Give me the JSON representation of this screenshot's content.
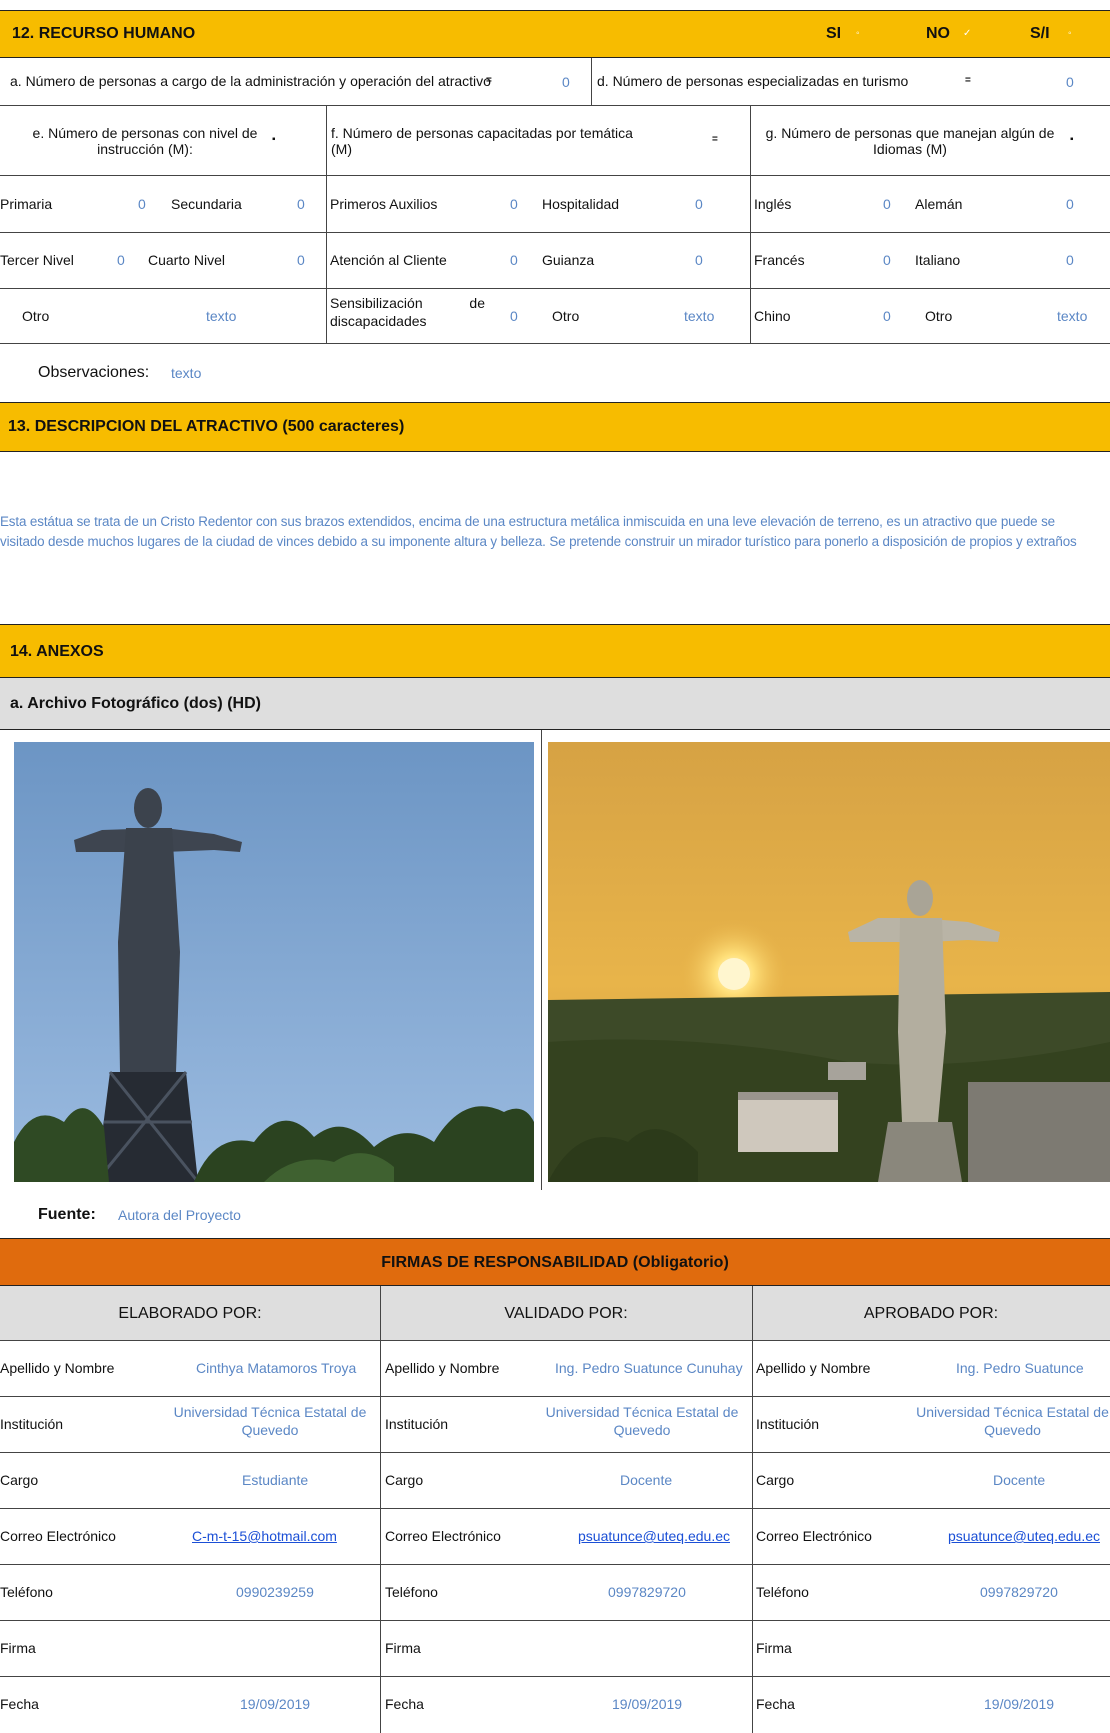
{
  "s12": {
    "title": "12. RECURSO HUMANO",
    "si": "SI",
    "no": "NO",
    "sn": "S/I",
    "si_mark": "◦",
    "no_mark": "✓",
    "sn_mark": "◦",
    "a_label": "a. Número de personas a cargo de la administración y operación del atractivo",
    "a_mark": "=",
    "a_val": "0",
    "d_label": "d. Número de personas especializadas en turismo",
    "d_mark": "=",
    "d_val": "0",
    "e_label": "e. Número de personas con nivel de instrucción (M):",
    "f_label": "f. Número de personas capacitadas por temática (M)",
    "g_label": "g. Número de personas que manejan algún de Idiomas (M)",
    "e_mark": "▪",
    "f_mark": "=",
    "g_mark": "▪",
    "primaria": "Primaria",
    "primaria_v": "0",
    "secundaria": "Secundaria",
    "secundaria_v": "0",
    "tercer": "Tercer Nivel",
    "tercer_v": "0",
    "cuarto": "Cuarto Nivel",
    "cuarto_v": "0",
    "otro_e": "Otro",
    "otro_e_v": "texto",
    "auxilios": "Primeros Auxilios",
    "auxilios_v": "0",
    "hospitalidad": "Hospitalidad",
    "hospitalidad_v": "0",
    "atencion": "Atención al Cliente",
    "atencion_v": "0",
    "guianza": "Guianza",
    "guianza_v": "0",
    "sensib": "Sensibilización de discapacidades",
    "sensib_v": "0",
    "otro_f": "Otro",
    "otro_f_v": "texto",
    "ingles": "Inglés",
    "ingles_v": "0",
    "aleman": "Alemán",
    "aleman_v": "0",
    "frances": "Francés",
    "frances_v": "0",
    "italiano": "Italiano",
    "italiano_v": "0",
    "chino": "Chino",
    "chino_v": "0",
    "otro_g": "Otro",
    "otro_g_v": "texto",
    "obs_label": "Observaciones:",
    "obs_val": "texto"
  },
  "s13": {
    "title": "13. DESCRIPCION DEL ATRACTIVO (500 caracteres)",
    "line1": "Esta estátua se trata de un Cristo Redentor con sus brazos extendidos, encima de una estructura metálica inmiscuida en una leve elevación de terreno, es un atractivo que puede se",
    "line2": "visitado desde muchos lugares de la ciudad de vinces debido a su imponente altura y belleza. Se pretende construir un mirador turístico para ponerlo a disposición de propios y extraños"
  },
  "s14": {
    "title": "14. ANEXOS",
    "photo_label": "a. Archivo Fotográfico (dos) (HD)",
    "fuente_label": "Fuente:",
    "fuente_val": "Autora del Proyecto"
  },
  "firmas": {
    "title": "FIRMAS DE RESPONSABILIDAD (Obligatorio)",
    "cols": [
      {
        "header": "ELABORADO POR:",
        "nombre": "Cinthya Matamoros Troya",
        "inst1": "Universidad Técnica Estatal de",
        "inst2": "Quevedo",
        "cargo": "Estudiante",
        "correo": "C-m-t-15@hotmail.com",
        "telefono": "0990239259",
        "firma": "",
        "fecha": "19/09/2019"
      },
      {
        "header": "VALIDADO POR:",
        "nombre": "Ing. Pedro Suatunce Cunuhay",
        "inst1": "Universidad Técnica Estatal de",
        "inst2": "Quevedo",
        "cargo": "Docente",
        "correo": "psuatunce@uteq.edu.ec",
        "telefono": "0997829720",
        "firma": "",
        "fecha": "19/09/2019"
      },
      {
        "header": "APROBADO POR:",
        "nombre": "Ing. Pedro Suatunce",
        "inst1": "Universidad Técnica Estatal de",
        "inst2": "Quevedo",
        "cargo": "Docente",
        "correo": "psuatunce@uteq.edu.ec",
        "telefono": "0997829720",
        "firma": "",
        "fecha": "19/09/2019"
      }
    ],
    "labels": {
      "nombre": "Apellido y Nombre",
      "inst": "Institución",
      "cargo": "Cargo",
      "correo": "Correo Electrónico",
      "telefono": "Teléfono",
      "firma": "Firma",
      "fecha": "Fecha"
    }
  }
}
